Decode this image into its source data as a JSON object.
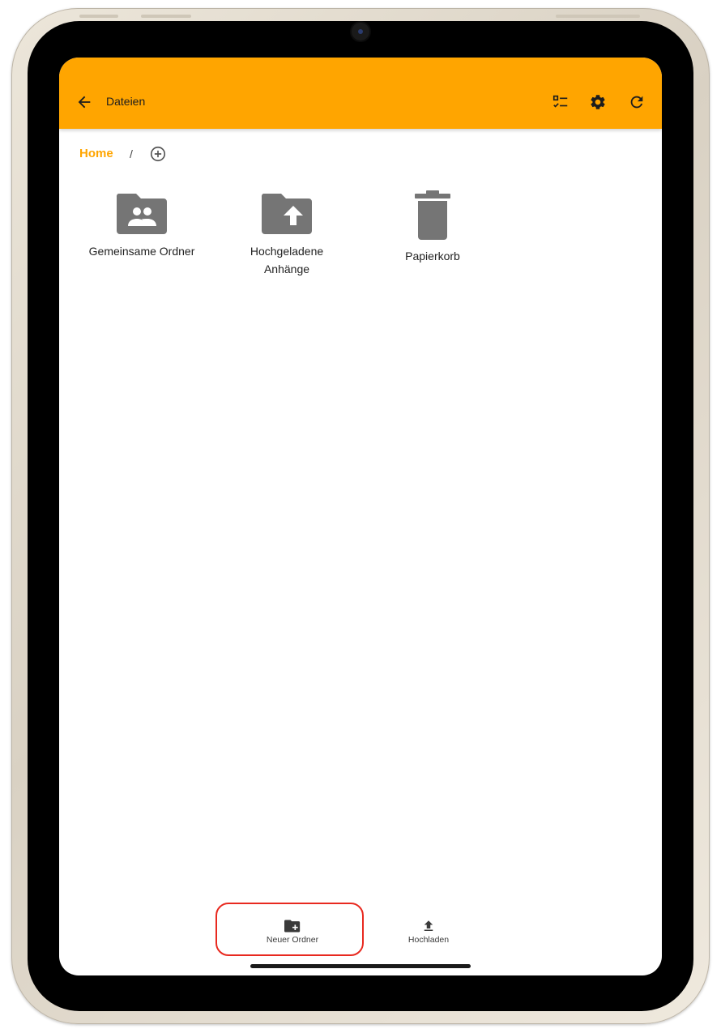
{
  "app_bar": {
    "title": "Dateien",
    "background_color": "#FFA500",
    "icons": {
      "back": "arrow-back-icon",
      "select": "checklist-icon",
      "settings": "gear-icon",
      "refresh": "refresh-icon"
    }
  },
  "breadcrumb": {
    "home": "Home",
    "separator": "/",
    "add_icon": "add-circle-icon"
  },
  "items": [
    {
      "label": "Gemeinsame Ordner",
      "icon": "shared-folder-icon"
    },
    {
      "label": "Hochgeladene Anhänge",
      "icon": "upload-folder-icon"
    },
    {
      "label": "Papierkorb",
      "icon": "trash-icon"
    }
  ],
  "bottom_bar": {
    "new_folder": {
      "label": "Neuer Ordner",
      "icon": "create-folder-icon"
    },
    "upload": {
      "label": "Hochladen",
      "icon": "upload-icon"
    }
  },
  "colors": {
    "accent": "#FFA500",
    "icon_gray": "#757575",
    "highlight": "#e8291f"
  }
}
